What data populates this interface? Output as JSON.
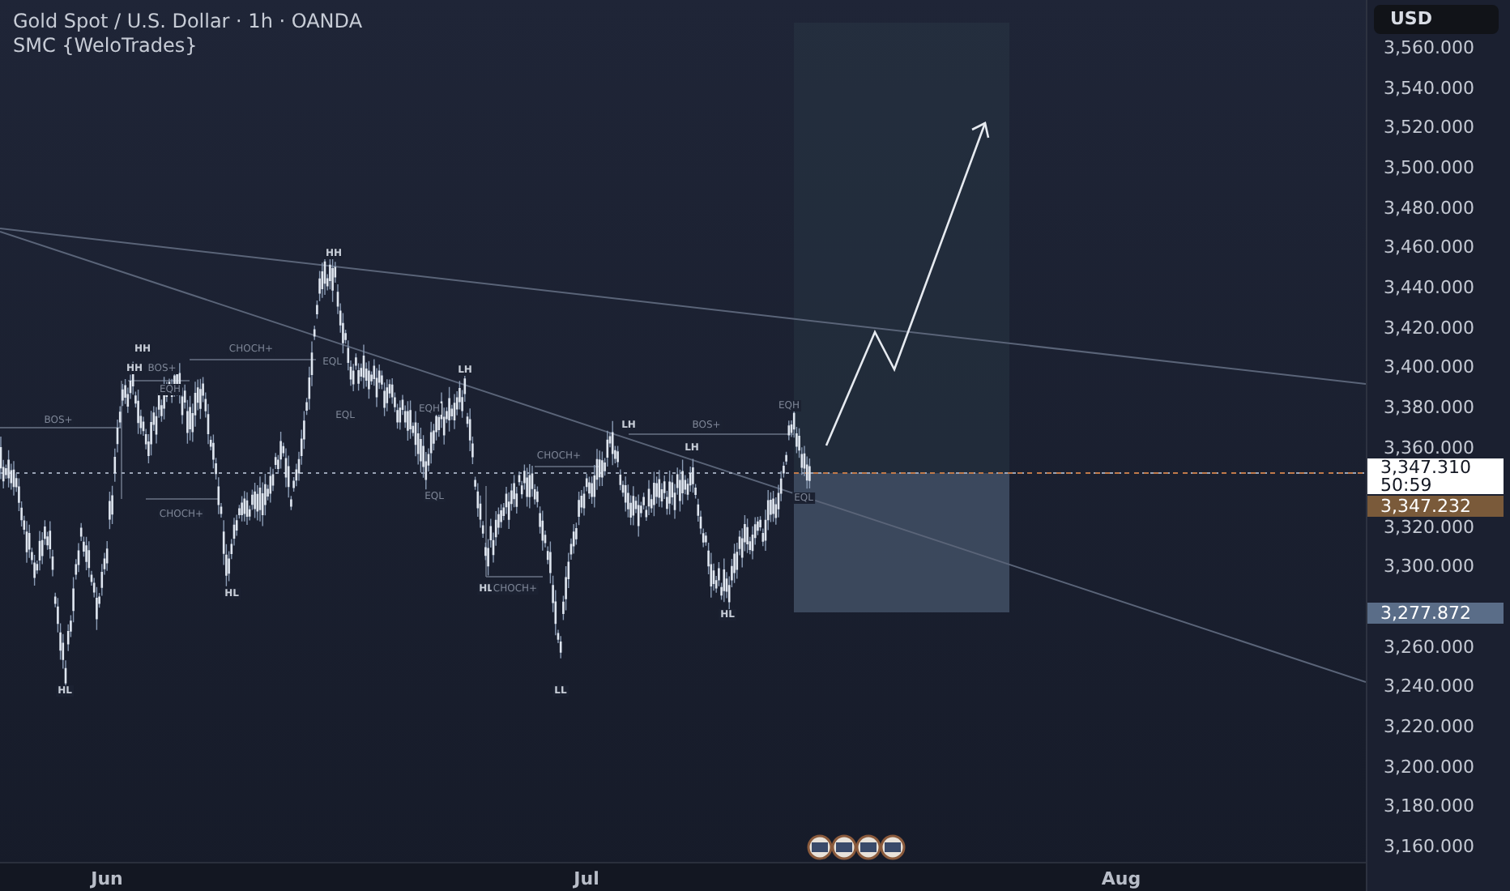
{
  "header": {
    "title": "Gold Spot / U.S. Dollar · 1h · OANDA",
    "indicator": "SMC {WeloTrades}"
  },
  "chart_labels": [
    {
      "text": "HH",
      "kind": "swing"
    },
    {
      "text": "HH",
      "kind": "swing"
    },
    {
      "text": "CHOCH+",
      "kind": "structure"
    },
    {
      "text": "HH",
      "kind": "swing"
    },
    {
      "text": "BOS+",
      "kind": "structure"
    },
    {
      "text": "EQH",
      "kind": "structure"
    },
    {
      "text": "BOS+",
      "kind": "structure"
    },
    {
      "text": "EQL",
      "kind": "structure"
    },
    {
      "text": "EQL",
      "kind": "structure"
    },
    {
      "text": "LH",
      "kind": "swing"
    },
    {
      "text": "EQH",
      "kind": "structure"
    },
    {
      "text": "EQL",
      "kind": "structure"
    },
    {
      "text": "CHOCH+",
      "kind": "structure"
    },
    {
      "text": "HL",
      "kind": "swing"
    },
    {
      "text": "HL",
      "kind": "swing"
    },
    {
      "text": "CHOCH+",
      "kind": "structure"
    },
    {
      "text": "LH",
      "kind": "swing"
    },
    {
      "text": "BOS+",
      "kind": "structure"
    },
    {
      "text": "LH",
      "kind": "swing"
    },
    {
      "text": "HL",
      "kind": "swing"
    },
    {
      "text": "HL",
      "kind": "swing"
    },
    {
      "text": "CHOCH+",
      "kind": "structure"
    },
    {
      "text": "LL",
      "kind": "swing"
    },
    {
      "text": "EQH",
      "kind": "structure"
    },
    {
      "text": "EQL",
      "kind": "structure"
    }
  ],
  "price_axis": {
    "currency": "USD",
    "ticks": [
      "3,560.000",
      "3,540.000",
      "3,520.000",
      "3,500.000",
      "3,480.000",
      "3,460.000",
      "3,440.000",
      "3,420.000",
      "3,400.000",
      "3,380.000",
      "3,360.000",
      "3,320.000",
      "3,300.000",
      "3,260.000",
      "3,240.000",
      "3,220.000",
      "3,200.000",
      "3,180.000",
      "3,160.000"
    ],
    "last_price": {
      "price": "3,347.310",
      "countdown": "50:59"
    },
    "entry_price": "3,347.232",
    "stop_price": "3,277.872"
  },
  "time_axis": [
    "Jun",
    "Jul",
    "Aug"
  ]
}
